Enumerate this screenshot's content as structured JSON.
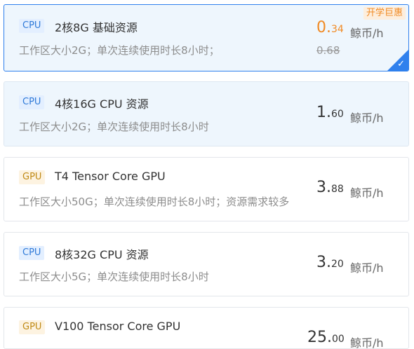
{
  "resources": [
    {
      "tag": "CPU",
      "title": "2核8G 基础资源",
      "desc": "工作区大小2G；单次连续使用时长8小时；",
      "price_int": "0.",
      "price_dec": "34",
      "unit": "鲸币/h",
      "old_price": "0.68",
      "promo": "开学巨惠",
      "selected": true
    },
    {
      "tag": "CPU",
      "title": "4核16G CPU 资源",
      "desc": "工作区大小2G；单次连续使用时长8小时",
      "price_int": "1.",
      "price_dec": "60",
      "unit": "鲸币/h"
    },
    {
      "tag": "GPU",
      "title": "T4 Tensor Core GPU",
      "desc": "工作区大小50G；单次连续使用时长8小时；资源需求较多",
      "price_int": "3.",
      "price_dec": "88",
      "unit": "鲸币/h"
    },
    {
      "tag": "CPU",
      "title": "8核32G CPU 资源",
      "desc": "工作区大小5G；单次连续使用时长8小时",
      "price_int": "3.",
      "price_dec": "20",
      "unit": "鲸币/h"
    },
    {
      "tag": "GPU",
      "title": "V100 Tensor Core GPU",
      "price_int": "25.",
      "price_dec": "00",
      "unit": "鲸币/h"
    }
  ]
}
